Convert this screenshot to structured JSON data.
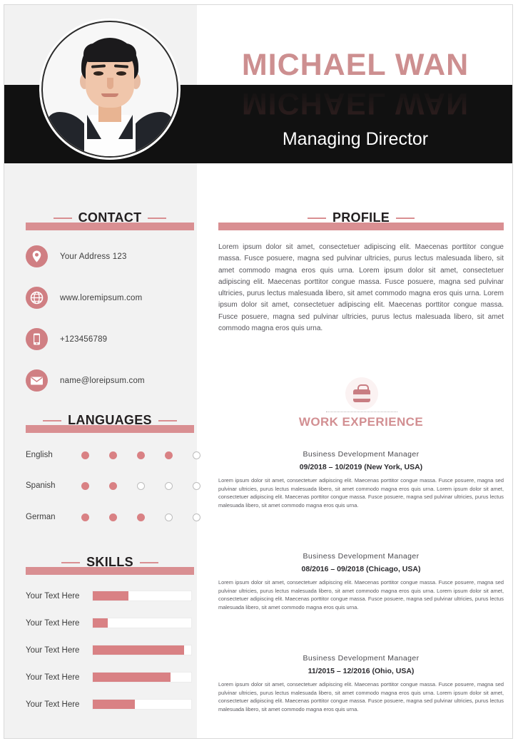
{
  "header": {
    "name": "MICHAEL WAN",
    "job_title": "Managing Director",
    "accent_color": "#d98f92",
    "name_color": "#cd8f90",
    "band_color": "#111111"
  },
  "sidebar": {
    "contact": {
      "heading": "CONTACT",
      "items": [
        {
          "icon": "location-pin-icon",
          "label": "Your Address  123"
        },
        {
          "icon": "globe-icon",
          "label": "www.loremipsum.com"
        },
        {
          "icon": "phone-icon",
          "label": "+123456789"
        },
        {
          "icon": "envelope-icon",
          "label": "name@loreipsum.com"
        }
      ]
    },
    "languages": {
      "heading": "LANGUAGES",
      "max": 5,
      "items": [
        {
          "label": "English",
          "rating": 4
        },
        {
          "label": "Spanish",
          "rating": 2
        },
        {
          "label": "German",
          "rating": 3
        }
      ]
    },
    "skills": {
      "heading": "SKILLS",
      "items": [
        {
          "label": "Your Text Here",
          "percent": 36
        },
        {
          "label": "Your Text Here",
          "percent": 15
        },
        {
          "label": "Your Text Here",
          "percent": 93
        },
        {
          "label": "Your Text Here",
          "percent": 79
        },
        {
          "label": "Your Text Here",
          "percent": 43
        }
      ]
    }
  },
  "main": {
    "profile": {
      "heading": "PROFILE",
      "text": "Lorem ipsum dolor sit amet, consectetuer adipiscing elit. Maecenas porttitor congue massa. Fusce posuere, magna sed pulvinar ultricies, purus lectus malesuada libero, sit amet commodo magna eros quis urna. Lorem ipsum dolor sit amet, consectetuer adipiscing elit. Maecenas porttitor congue massa. Fusce posuere, magna sed pulvinar ultricies, purus lectus malesuada libero, sit amet commodo magna eros quis urna. Lorem ipsum dolor sit amet, consectetuer adipiscing elit. Maecenas porttitor congue massa. Fusce posuere, magna sed pulvinar ultricies, purus lectus malesuada libero, sit amet commodo magna eros quis urna."
    },
    "work_experience": {
      "heading": "WORK EXPERIENCE",
      "icon": "briefcase-icon",
      "jobs": [
        {
          "role": "Business Development  Manager",
          "meta": "09/2018 – 10/2019 (New York, USA)",
          "desc": "Lorem ipsum dolor sit amet, consectetuer adipiscing elit. Maecenas porttitor congue massa. Fusce posuere, magna sed pulvinar ultricies, purus lectus malesuada libero, sit amet commodo magna eros quis urna. Lorem ipsum dolor sit amet, consectetuer adipiscing elit. Maecenas porttitor congue massa. Fusce posuere, magna sed pulvinar ultricies, purus lectus malesuada libero, sit amet commodo magna eros quis urna."
        },
        {
          "role": "Business Development  Manager",
          "meta": "08/2016 – 09/2018 (Chicago, USA)",
          "desc": "Lorem ipsum dolor sit amet, consectetuer adipiscing elit. Maecenas porttitor congue massa. Fusce posuere, magna sed pulvinar ultricies, purus lectus malesuada libero, sit amet commodo magna eros quis urna. Lorem ipsum dolor sit amet, consectetuer adipiscing elit. Maecenas porttitor congue massa. Fusce posuere, magna sed pulvinar ultricies, purus lectus malesuada libero, sit amet commodo magna eros quis urna."
        },
        {
          "role": "Business Development  Manager",
          "meta": "11/2015 – 12/2016 (Ohio, USA)",
          "desc": "Lorem ipsum dolor sit amet, consectetuer adipiscing elit. Maecenas porttitor congue massa. Fusce posuere, magna sed pulvinar ultricies, purus lectus malesuada libero, sit amet commodo magna eros quis urna. Lorem ipsum dolor sit amet, consectetuer adipiscing elit. Maecenas porttitor congue massa. Fusce posuere, magna sed pulvinar ultricies, purus lectus malesuada libero, sit amet commodo magna eros quis urna."
        }
      ]
    }
  }
}
